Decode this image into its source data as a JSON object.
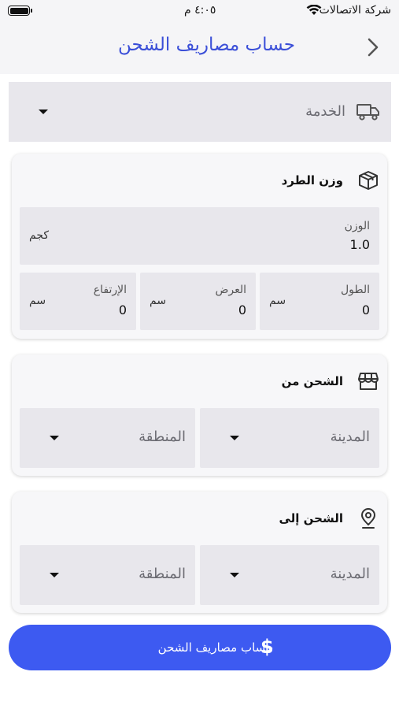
{
  "status_bar": {
    "carrier": "شركة الاتصالات",
    "time": "٤:٠٥ م"
  },
  "header": {
    "title": "حساب مصاريف الشحن"
  },
  "service": {
    "placeholder": "الخدمة"
  },
  "package": {
    "title": "وزن الطرد",
    "weight": {
      "label": "الوزن",
      "value": "1.0",
      "unit": "كجم"
    },
    "length": {
      "label": "الطول",
      "value": "0",
      "unit": "سم"
    },
    "width": {
      "label": "العرض",
      "value": "0",
      "unit": "سم"
    },
    "height": {
      "label": "الإرتفاع",
      "value": "0",
      "unit": "سم"
    }
  },
  "ship_from": {
    "title": "الشحن من",
    "city": "المدينة",
    "region": "المنطقة"
  },
  "ship_to": {
    "title": "الشحن إلى",
    "city": "المدينة",
    "region": "المنطقة"
  },
  "action": {
    "label": "حساب مصاريف الشحن",
    "icon": "dollar-icon"
  },
  "colors": {
    "accent": "#3d5af1",
    "title": "#3b4fd8",
    "field_bg": "#e8e7ec"
  }
}
